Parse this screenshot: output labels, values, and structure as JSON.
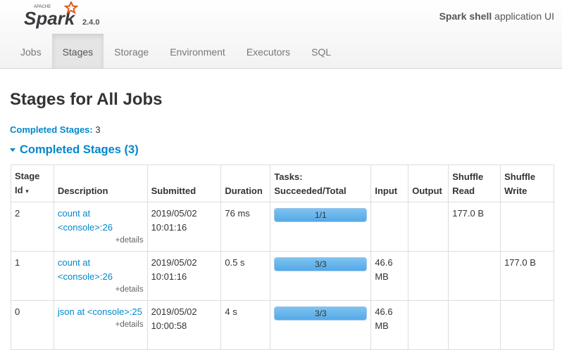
{
  "brand": {
    "apache": "APACHE",
    "name": "Spark",
    "version": "2.4.0"
  },
  "app": {
    "name": "Spark shell",
    "suffix": "application UI"
  },
  "nav": {
    "tabs": [
      {
        "label": "Jobs",
        "active": false
      },
      {
        "label": "Stages",
        "active": true
      },
      {
        "label": "Storage",
        "active": false
      },
      {
        "label": "Environment",
        "active": false
      },
      {
        "label": "Executors",
        "active": false
      },
      {
        "label": "SQL",
        "active": false
      }
    ]
  },
  "page": {
    "title": "Stages for All Jobs",
    "summary_label": "Completed Stages:",
    "summary_value": "3",
    "section_title": "Completed Stages (3)"
  },
  "table": {
    "headers": {
      "stage_id": "Stage Id",
      "sort_indicator": "▾",
      "description": "Description",
      "submitted": "Submitted",
      "duration": "Duration",
      "tasks": "Tasks: Succeeded/Total",
      "input": "Input",
      "output": "Output",
      "shuffle_read": "Shuffle Read",
      "shuffle_write": "Shuffle Write"
    },
    "details_label": "+details",
    "rows": [
      {
        "stage_id": "2",
        "description": "count at <console>:26",
        "submitted": "2019/05/02 10:01:16",
        "duration": "76 ms",
        "tasks_label": "1/1",
        "tasks_fraction": 1.0,
        "input": "",
        "output": "",
        "shuffle_read": "177.0 B",
        "shuffle_write": ""
      },
      {
        "stage_id": "1",
        "description": "count at <console>:26",
        "submitted": "2019/05/02 10:01:16",
        "duration": "0.5 s",
        "tasks_label": "3/3",
        "tasks_fraction": 1.0,
        "input": "46.6 MB",
        "output": "",
        "shuffle_read": "",
        "shuffle_write": "177.0 B"
      },
      {
        "stage_id": "0",
        "description": "json at <console>:25",
        "submitted": "2019/05/02 10:00:58",
        "duration": "4 s",
        "tasks_label": "3/3",
        "tasks_fraction": 1.0,
        "input": "46.6 MB",
        "output": "",
        "shuffle_read": "",
        "shuffle_write": ""
      }
    ]
  },
  "colors": {
    "accent": "#0088cc",
    "brand_orange": "#e25a1c",
    "progress": "#5bb0ea"
  }
}
